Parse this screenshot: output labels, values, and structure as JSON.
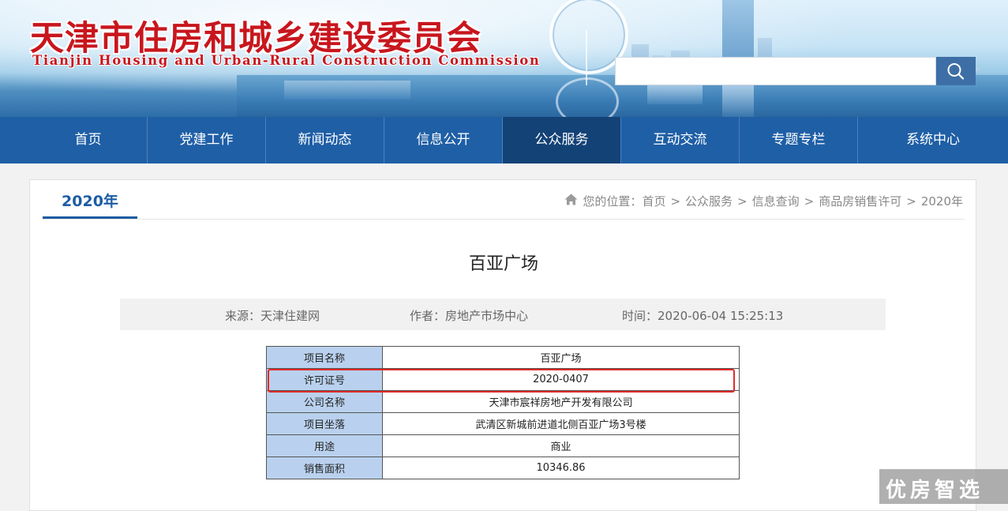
{
  "header": {
    "title": "天津市住房和城乡建设委员会",
    "subtitle": "Tianjin Housing and Urban-Rural Construction Commission",
    "search_placeholder": ""
  },
  "nav": {
    "items": [
      {
        "label": "首页"
      },
      {
        "label": "党建工作"
      },
      {
        "label": "新闻动态"
      },
      {
        "label": "信息公开"
      },
      {
        "label": "公众服务"
      },
      {
        "label": "互动交流"
      },
      {
        "label": "专题专栏"
      },
      {
        "label": "系统中心"
      }
    ],
    "active_index": 4
  },
  "content": {
    "tab_label": "2020年",
    "breadcrumb": {
      "prefix": "您的位置：",
      "items": [
        "首页",
        "公众服务",
        "信息查询",
        "商品房销售许可",
        "2020年"
      ],
      "separator": ">"
    },
    "article_title": "百亚广场",
    "meta": {
      "source": "来源：天津住建网",
      "author": "作者：房地产市场中心",
      "time": "时间：2020-06-04 15:25:13"
    },
    "table": [
      {
        "key": "项目名称",
        "value": "百亚广场"
      },
      {
        "key": "许可证号",
        "value": "2020-0407"
      },
      {
        "key": "公司名称",
        "value": "天津市宸祥房地产开发有限公司"
      },
      {
        "key": "项目坐落",
        "value": "武清区新城前进道北侧百亚广场3号楼"
      },
      {
        "key": "用途",
        "value": "商业"
      },
      {
        "key": "销售面积",
        "value": "10346.86"
      }
    ]
  },
  "watermark": "优房智选",
  "colors": {
    "nav_bg": "#1f5fa6",
    "nav_active": "#134277",
    "title_red": "#c8161d",
    "table_key_bg": "#b9d1ee",
    "highlight_red": "#e12a2a"
  },
  "icons": [
    "search-icon",
    "home-icon"
  ]
}
